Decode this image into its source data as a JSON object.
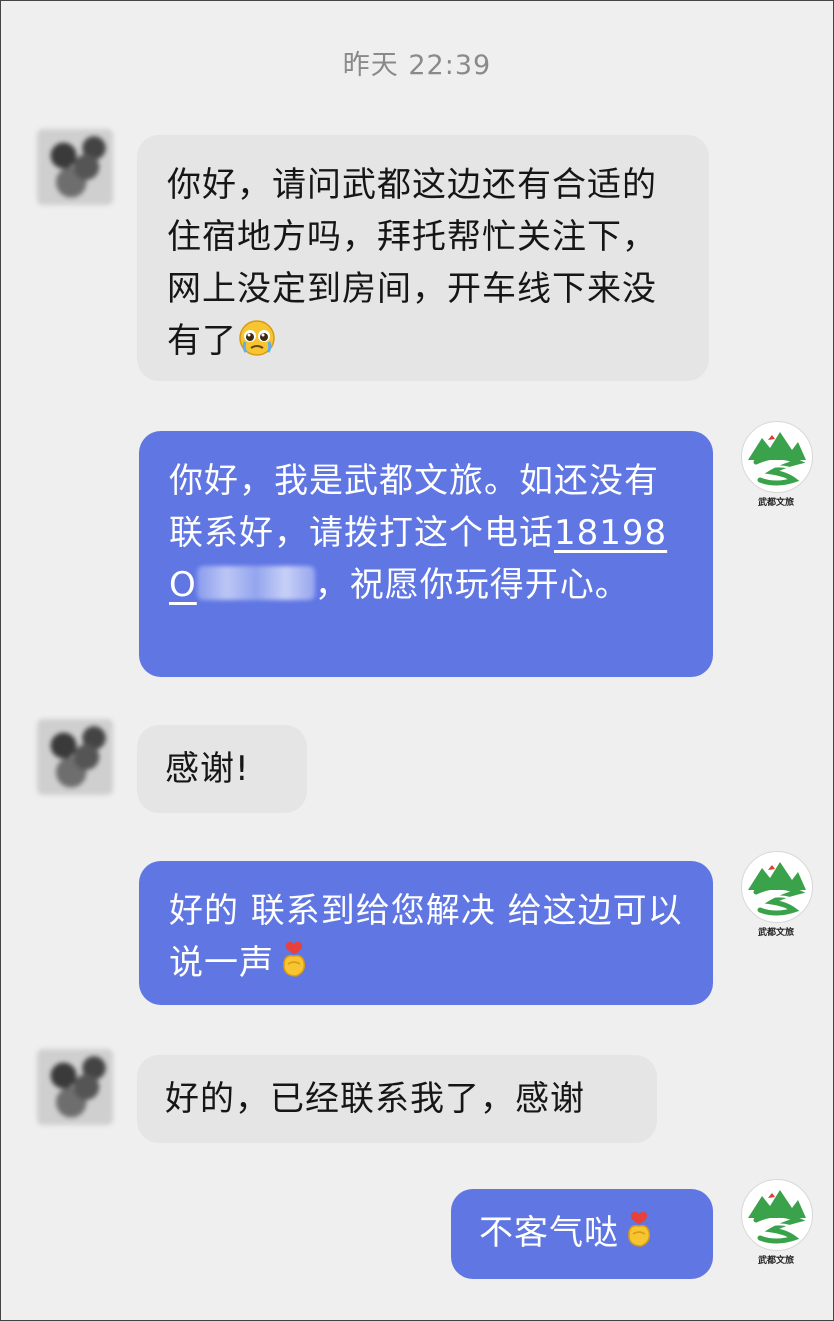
{
  "chat": {
    "timestamp": "昨天 22:39",
    "contact_logo_caption": "武都文旅",
    "messages": [
      {
        "from": "user",
        "text": "你好，请问武都这边还有合适的住宿地方吗，拜托帮忙关注下，网上没定到房间，开车线下来没有了",
        "emoji": "pleading-face-icon"
      },
      {
        "from": "official",
        "text_before_phone": "你好，我是武都文旅。如还没有联系好，请拨打这个电话",
        "phone_visible": "18198O",
        "text_after_phone": "，祝愿你玩得开心。"
      },
      {
        "from": "user",
        "text": "感谢!"
      },
      {
        "from": "official",
        "text": "好的 联系到给您解决 给这边可以说一声",
        "emoji": "finger-heart-icon"
      },
      {
        "from": "user",
        "text": "好的，已经联系我了，感谢"
      },
      {
        "from": "official",
        "text": "不客气哒",
        "emoji": "finger-heart-icon"
      }
    ]
  }
}
